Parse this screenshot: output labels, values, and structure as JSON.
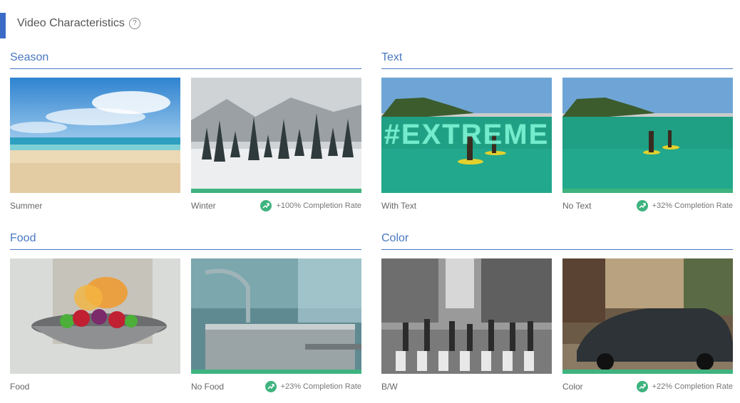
{
  "page": {
    "title": "Video Characteristics",
    "help_glyph": "?"
  },
  "sections": [
    {
      "title": "Season",
      "cards": [
        {
          "label": "Summer"
        },
        {
          "label": "Winter",
          "rate": "+100% Completion Rate"
        }
      ]
    },
    {
      "title": "Text",
      "cards": [
        {
          "label": "With Text",
          "overlay": "#EXTREME"
        },
        {
          "label": "No Text",
          "rate": "+32% Completion Rate"
        }
      ]
    },
    {
      "title": "Food",
      "cards": [
        {
          "label": "Food"
        },
        {
          "label": "No Food",
          "rate": "+23% Completion Rate"
        }
      ]
    },
    {
      "title": "Color",
      "cards": [
        {
          "label": "B/W"
        },
        {
          "label": "Color",
          "rate": "+22% Completion Rate"
        }
      ]
    }
  ],
  "colors": {
    "accent": "#3a6cc7",
    "section_title": "#4a78c0",
    "winner": "#3fb37f"
  },
  "icons": {
    "help": "help-circle-icon",
    "trend": "trend-up-icon"
  }
}
